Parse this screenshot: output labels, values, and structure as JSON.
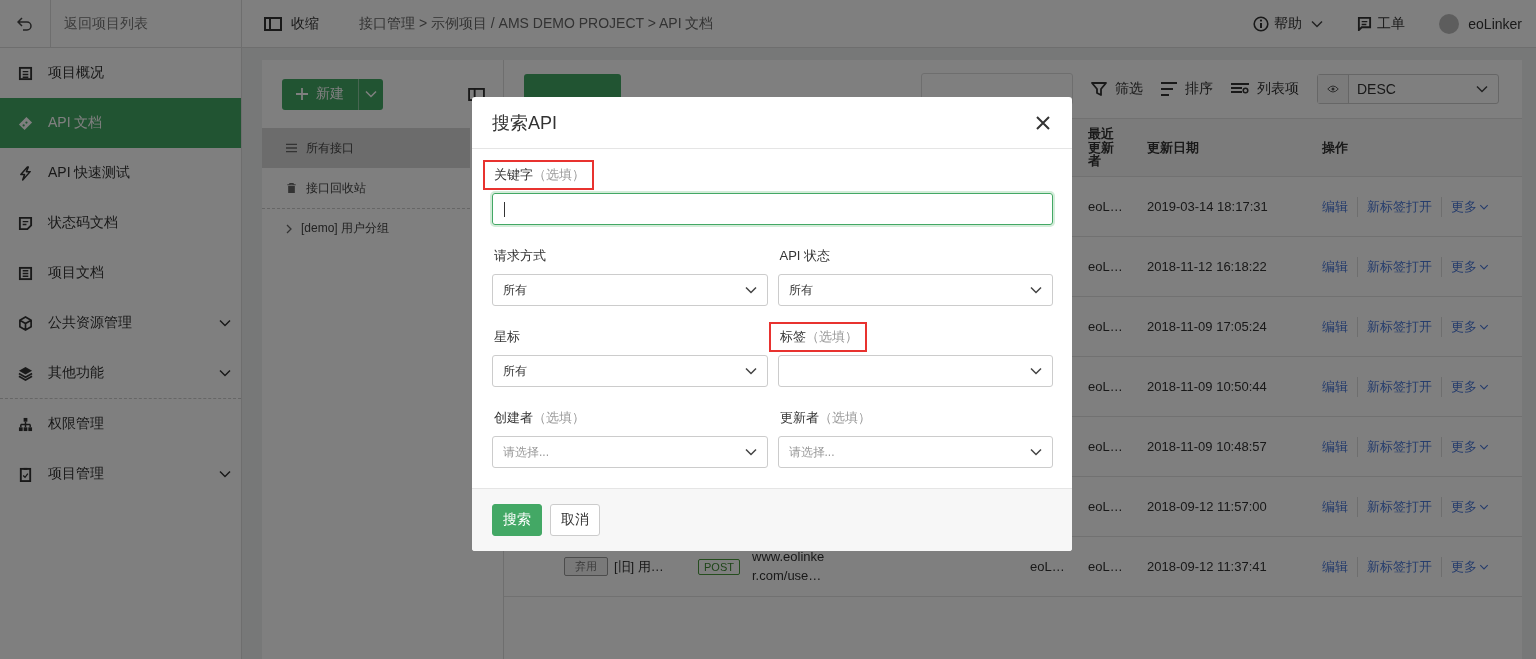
{
  "sidebar": {
    "back_label": "返回项目列表",
    "groups": [
      {
        "items": [
          {
            "kind": "overview",
            "label": "项目概况",
            "selected": false,
            "expandable": false
          },
          {
            "kind": "api",
            "label": "API 文档",
            "selected": true,
            "expandable": false
          },
          {
            "kind": "test",
            "label": "API 快速测试",
            "selected": false,
            "expandable": false
          },
          {
            "kind": "status",
            "label": "状态码文档",
            "selected": false,
            "expandable": false
          },
          {
            "kind": "docs",
            "label": "项目文档",
            "selected": false,
            "expandable": false
          },
          {
            "kind": "resources",
            "label": "公共资源管理",
            "selected": false,
            "expandable": true
          },
          {
            "kind": "more",
            "label": "其他功能",
            "selected": false,
            "expandable": true
          }
        ]
      },
      {
        "items": [
          {
            "kind": "permissions",
            "label": "权限管理",
            "selected": false,
            "expandable": false
          },
          {
            "kind": "project",
            "label": "项目管理",
            "selected": false,
            "expandable": true
          }
        ]
      }
    ]
  },
  "topbar": {
    "collapse_label": "收缩",
    "breadcrumb": "接口管理 > 示例项目 / AMS DEMO PROJECT > API 文档",
    "help": "帮助",
    "tickets": "工单",
    "user": "eoLinker"
  },
  "group_panel": {
    "new_button": "新建",
    "items": [
      {
        "kind": "all",
        "label": "所有接口",
        "selected": true
      },
      {
        "kind": "trash",
        "label": "接口回收站",
        "selected": false
      },
      {
        "kind": "group",
        "label": "[demo] 用户分组",
        "selected": false
      }
    ]
  },
  "api_list": {
    "toolbar": [
      {
        "kind": "filter",
        "label": "筛选"
      },
      {
        "kind": "sort",
        "label": "排序"
      },
      {
        "kind": "columns",
        "label": "列表项"
      }
    ],
    "order_select": {
      "value": "DESC"
    },
    "columns": [
      "最近更新者",
      "更新日期",
      "操作"
    ],
    "rows": [
      {
        "updater": "eoL…",
        "date": "2019-03-14 18:17:31",
        "actions": [
          "编辑",
          "新标签打开",
          "更多"
        ]
      },
      {
        "updater": "eoL…",
        "date": "2018-11-12 16:18:22",
        "actions": [
          "编辑",
          "新标签打开",
          "更多"
        ]
      },
      {
        "updater": "eoL…",
        "date": "2018-11-09 17:05:24",
        "actions": [
          "编辑",
          "新标签打开",
          "更多"
        ]
      },
      {
        "updater": "eoL…",
        "date": "2018-11-09 10:50:44",
        "actions": [
          "编辑",
          "新标签打开",
          "更多"
        ]
      },
      {
        "updater": "eoL…",
        "date": "2018-11-09 10:48:57",
        "actions": [
          "编辑",
          "新标签打开",
          "更多"
        ]
      },
      {
        "updater": "eoL…",
        "date": "2018-09-12 11:57:00",
        "actions": [
          "编辑",
          "新标签打开",
          "更多"
        ]
      },
      {
        "status": "弃用",
        "name": "[旧] 用…",
        "method": "POST",
        "url": "www.eolinker.com/use…",
        "creator": "eoL…",
        "updater": "eoL…",
        "date": "2018-09-12 11:37:41",
        "actions": [
          "编辑",
          "新标签打开",
          "更多"
        ]
      }
    ]
  },
  "modal": {
    "title": "搜索API",
    "fields": [
      {
        "kind": "text",
        "label": "关键字",
        "hint": "（选填）",
        "highlighted": true,
        "focused": true
      },
      {
        "kind": "select",
        "label": "请求方式",
        "value": "所有",
        "highlighted": false
      },
      {
        "kind": "select",
        "label": "API 状态",
        "value": "所有",
        "highlighted": false
      },
      {
        "kind": "select",
        "label": "星标",
        "value": "所有",
        "highlighted": false
      },
      {
        "kind": "select",
        "label": "标签",
        "hint": "（选填）",
        "highlighted": true
      },
      {
        "kind": "select",
        "label": "创建者",
        "hint": "（选填）",
        "placeholder": "请选择...",
        "highlighted": false
      },
      {
        "kind": "select",
        "label": "更新者",
        "hint": "（选填）",
        "placeholder": "请选择...",
        "highlighted": false
      }
    ],
    "buttons": [
      {
        "kind": "primary",
        "label": "搜索"
      },
      {
        "kind": "default",
        "label": "取消"
      }
    ]
  }
}
